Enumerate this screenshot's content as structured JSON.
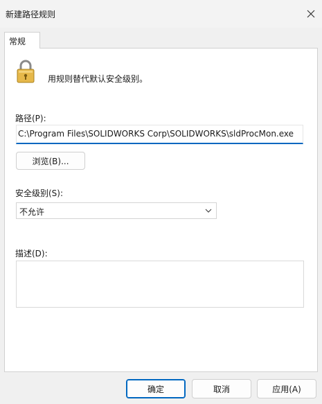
{
  "window": {
    "title": "新建路径规则",
    "close_icon": "close-icon"
  },
  "tabs": [
    {
      "label": "常规",
      "active": true
    }
  ],
  "general": {
    "icon": "lock-icon",
    "description": "用规则替代默认安全级别。",
    "path_label": "路径(P):",
    "path_value": "C:\\Program Files\\SOLIDWORKS Corp\\SOLIDWORKS\\sldProcMon.exe",
    "browse_label": "浏览(B)...",
    "security_level_label": "安全级别(S):",
    "security_level_value": "不允许",
    "description_label": "描述(D):",
    "description_value": ""
  },
  "footer": {
    "ok_label": "确定",
    "cancel_label": "取消",
    "apply_label": "应用(A)"
  },
  "colors": {
    "accent": "#0067c0",
    "window_bg": "#f0f0f0",
    "panel_bg": "#ffffff"
  }
}
